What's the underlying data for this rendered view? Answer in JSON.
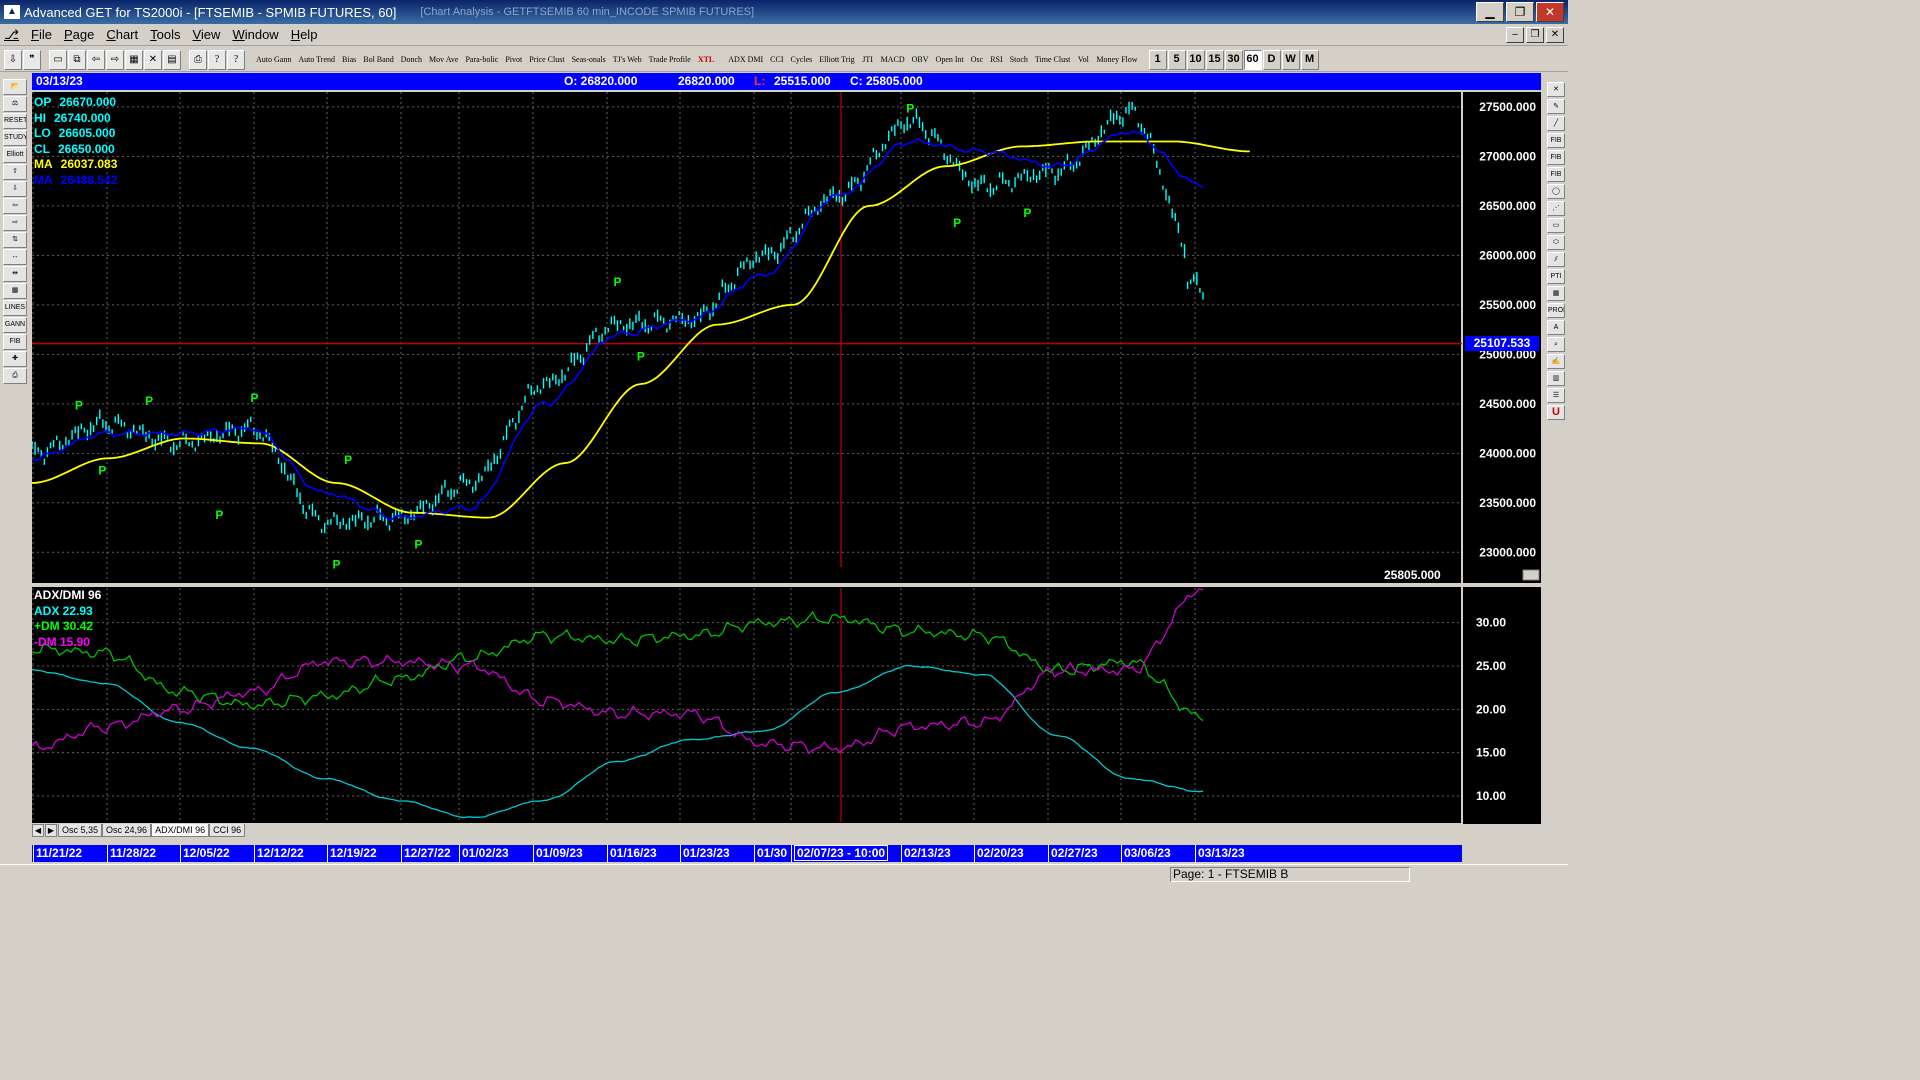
{
  "window": {
    "title": "Advanced GET for TS2000i - [FTSEMIB - SPMIB FUTURES, 60]",
    "ghost_title": "[Chart Analysis - GETFTSEMIB 60 min_INCODE SPMIB FUTURES]",
    "app_icon": "chart-app-icon",
    "buttons": [
      "minimize-icon",
      "restore-icon",
      "close-icon"
    ]
  },
  "menu": [
    "File",
    "Page",
    "Chart",
    "Tools",
    "View",
    "Window",
    "Help"
  ],
  "toolbar": {
    "icon_buttons": [
      "pin-icon",
      "quote-icon",
      "new-icon",
      "copy-icon",
      "back-icon",
      "forward-icon",
      "grid-icon",
      "cross-icon",
      "table-icon",
      "print-icon",
      "help-icon",
      "whatis-icon"
    ],
    "study_buttons": [
      "Auto Gann",
      "Auto Trend",
      "Bias",
      "Bol Band",
      "Donch",
      "Mov Ave",
      "Para-bolic",
      "Pivot",
      "Price Clust",
      "Seas-onals",
      "TJ's Web",
      "Trade Profile",
      "XTL",
      "ADX DMI",
      "CCI",
      "Cycles",
      "Elliott Trig",
      "JTI",
      "MACD",
      "OBV",
      "Open Int",
      "Osc",
      "RSI",
      "Stoch",
      "Time Clust",
      "Vol",
      "Money Flow"
    ],
    "interval_buttons": [
      "1",
      "5",
      "10",
      "15",
      "30",
      "60",
      "D",
      "W",
      "M"
    ],
    "active_interval": "60"
  },
  "left_tools": [
    "open-icon",
    "compare-icon",
    "RESET",
    "STUDY",
    "Elliott",
    "up-arrow-icon",
    "down-arrow-icon",
    "left-arrow-icon",
    "right-arrow-icon",
    "zoom-bars-icon",
    "expand-icon",
    "compress-icon",
    "grid-icon",
    "LINES",
    "GANN",
    "FIB",
    "crosshair-icon",
    "print-icon"
  ],
  "right_tools": [
    "close-x-icon",
    "pencil-icon",
    "line-icon",
    "FIB RET",
    "FIB EXT",
    "FIB TIME",
    "circle-icon",
    "fan-icon",
    "box-icon",
    "ellipse-icon",
    "channel-icon",
    "PTI",
    "grid-icon",
    "PROB",
    "A",
    "zoom-icon",
    "paint-icon",
    "bars-icon",
    "list-icon",
    "U"
  ],
  "info_bar": {
    "date": "03/13/23",
    "open": "O: 26820.000",
    "high": "26820.000",
    "low_label": "L:",
    "low": "25515.000",
    "close": "C: 25805.000"
  },
  "price_legend": [
    {
      "label": "OP",
      "value": "26670.000",
      "color": "#00ffff"
    },
    {
      "label": "HI",
      "value": "26740.000",
      "color": "#00ffff"
    },
    {
      "label": "LO",
      "value": "26605.000",
      "color": "#00ffff"
    },
    {
      "label": "CL",
      "value": "26650.000",
      "color": "#00ffff"
    },
    {
      "label": "MA",
      "value": "26037.083",
      "color": "#ffff00"
    },
    {
      "label": "MA",
      "value": "26488.542",
      "color": "#0000ff"
    }
  ],
  "osc_legend": [
    {
      "text": "ADX/DMI 96",
      "color": "#ffffff"
    },
    {
      "text": "ADX 22.93",
      "color": "#00ffff"
    },
    {
      "text": "+DM 30.42",
      "color": "#00ff00"
    },
    {
      "text": "-DM  15.90",
      "color": "#ff00ff"
    }
  ],
  "price_axis_labels": [
    "27500.000",
    "27000.000",
    "26500.000",
    "26000.000",
    "25500.000",
    "25000.000",
    "24500.000",
    "24000.000",
    "23500.000",
    "23000.000"
  ],
  "osc_axis_labels": [
    "30.00",
    "25.00",
    "20.00",
    "15.00",
    "10.00"
  ],
  "highlight_price": "25107.533",
  "last_price": "25805.000",
  "pivot_marker": "P",
  "osc_tabs": [
    "Osc 5,35",
    "Osc 24,96",
    "ADX/DMI 96",
    "CCI 96"
  ],
  "active_osc_tab": "ADX/DMI 96",
  "date_labels": [
    "11/21/22",
    "11/28/22",
    "12/05/22",
    "12/12/22",
    "12/19/22",
    "12/27/22",
    "01/02/23",
    "01/09/23",
    "01/16/23",
    "01/23/23",
    "01/30",
    "02/07/23 - 10:00",
    "02/13/23",
    "02/20/23",
    "02/27/23",
    "03/06/23",
    "03/13/23"
  ],
  "cursor_date": "02/07/23 - 10:00",
  "status": "Page: 1 - FTSEMIB B",
  "colors": {
    "price_bars": "#00ffff",
    "ma_slow": "#ffff00",
    "ma_fast": "#0000ff",
    "adx": "#00c8d0",
    "plus_dm": "#00c000",
    "minus_dm": "#d000d0",
    "pivot": "#00ff00",
    "cursor_line": "#c00000",
    "info_bar": "#0000ff"
  },
  "chart_data": [
    {
      "type": "line",
      "title": "FTSEMIB - SPMIB FUTURES, 60",
      "xlabel": "",
      "ylabel": "",
      "x": [
        "11/21/22",
        "11/28/22",
        "12/05/22",
        "12/12/22",
        "12/19/22",
        "12/27/22",
        "01/02/23",
        "01/09/23",
        "01/16/23",
        "01/23/23",
        "01/30",
        "02/07/23",
        "02/13/23",
        "02/20/23",
        "02/27/23",
        "03/06/23",
        "03/13/23"
      ],
      "ylim": [
        22700,
        27650
      ],
      "grid": true,
      "series": [
        {
          "values": [
            24000,
            24300,
            24100,
            24250,
            23300,
            23350,
            23700,
            24700,
            25300,
            25350,
            26000,
            26600,
            27350,
            26700,
            26850,
            27450,
            25800
          ]
        },
        {
          "values": [
            23700,
            23950,
            24150,
            24100,
            23700,
            23400,
            23350,
            23900,
            24700,
            25300,
            25500,
            26500,
            26900,
            27100,
            27150,
            27150,
            27050
          ]
        },
        {
          "values": [
            23950,
            24200,
            24200,
            24250,
            23600,
            23350,
            23450,
            24500,
            25200,
            25350,
            25800,
            26600,
            27150,
            27050,
            26900,
            27250,
            26700
          ]
        }
      ]
    },
    {
      "type": "line",
      "title": "ADX/DMI 96",
      "x": [
        "11/21/22",
        "11/28/22",
        "12/05/22",
        "12/12/22",
        "12/19/22",
        "12/27/22",
        "01/02/23",
        "01/09/23",
        "01/16/23",
        "01/23/23",
        "01/30",
        "02/07/23",
        "02/13/23",
        "02/20/23",
        "02/27/23",
        "03/06/23",
        "03/13/23"
      ],
      "ylim": [
        7,
        34
      ],
      "grid": true,
      "series": [
        {
          "name": "ADX",
          "values": [
            24.5,
            23.0,
            18.5,
            15.5,
            12.0,
            9.5,
            7.5,
            9.5,
            14.0,
            16.5,
            17.5,
            22.0,
            25.0,
            24.0,
            17.0,
            12.0,
            10.5
          ]
        },
        {
          "name": "+DM",
          "values": [
            27.0,
            26.5,
            22.0,
            20.5,
            21.5,
            23.5,
            26.0,
            28.5,
            28.0,
            28.5,
            30.0,
            30.5,
            29.0,
            28.5,
            24.5,
            25.5,
            19.0
          ]
        },
        {
          "name": "-DM",
          "values": [
            15.5,
            18.0,
            20.0,
            22.0,
            25.5,
            25.5,
            25.0,
            21.0,
            19.5,
            19.5,
            16.0,
            15.5,
            18.0,
            18.5,
            24.5,
            24.5,
            34.0
          ]
        }
      ]
    }
  ]
}
